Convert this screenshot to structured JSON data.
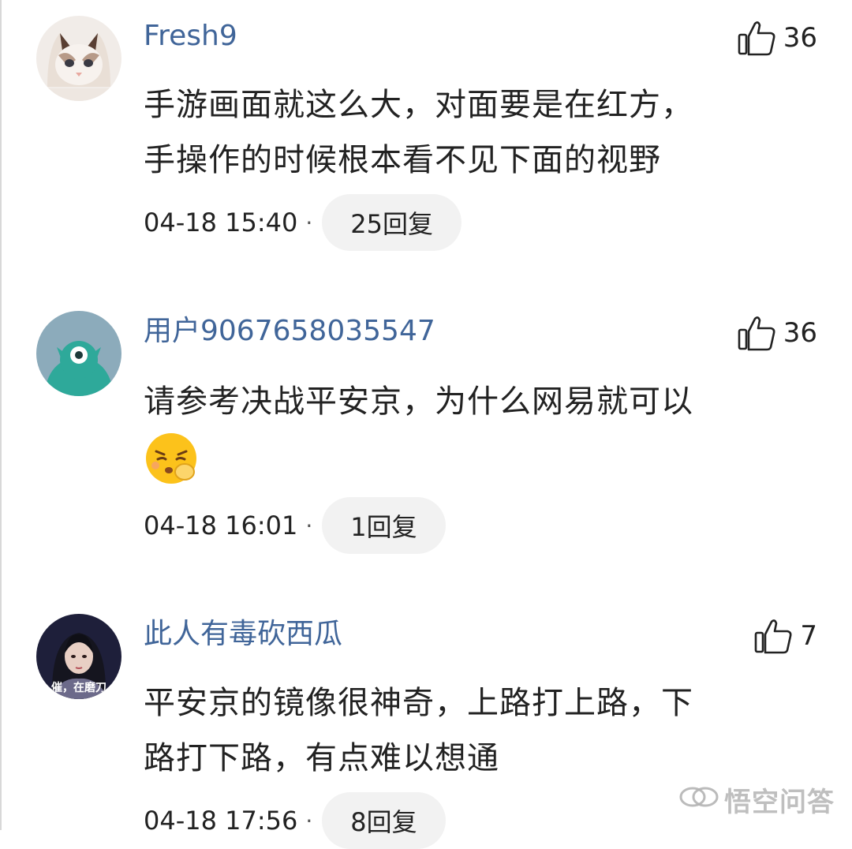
{
  "comments": [
    {
      "username": "Fresh9",
      "likes": "36",
      "lines": [
        "手游画面就这么大，对面要是在红方，",
        "手操作的时候根本看不见下面的视野"
      ],
      "time": "04-18 15:40",
      "replies": "25回复"
    },
    {
      "username": "用户9067658035547",
      "likes": "36",
      "lines": [
        "请参考决战平安京，为什么网易就可以"
      ],
      "emoji": "shushing-face-emoji",
      "time": "04-18 16:01",
      "replies": "1回复"
    },
    {
      "username": "此人有毒砍西瓜",
      "likes": "7",
      "avatar_caption": "催，在磨刀",
      "lines": [
        "平安京的镜像很神奇，上路打上路，下",
        "路打下路，有点难以想通"
      ],
      "time": "04-18 17:56",
      "replies": "8回复"
    }
  ],
  "separator": "·",
  "watermark": "悟空问答",
  "colors": {
    "username": "#406599",
    "text": "#222222",
    "reply_bg": "#f2f2f2"
  }
}
